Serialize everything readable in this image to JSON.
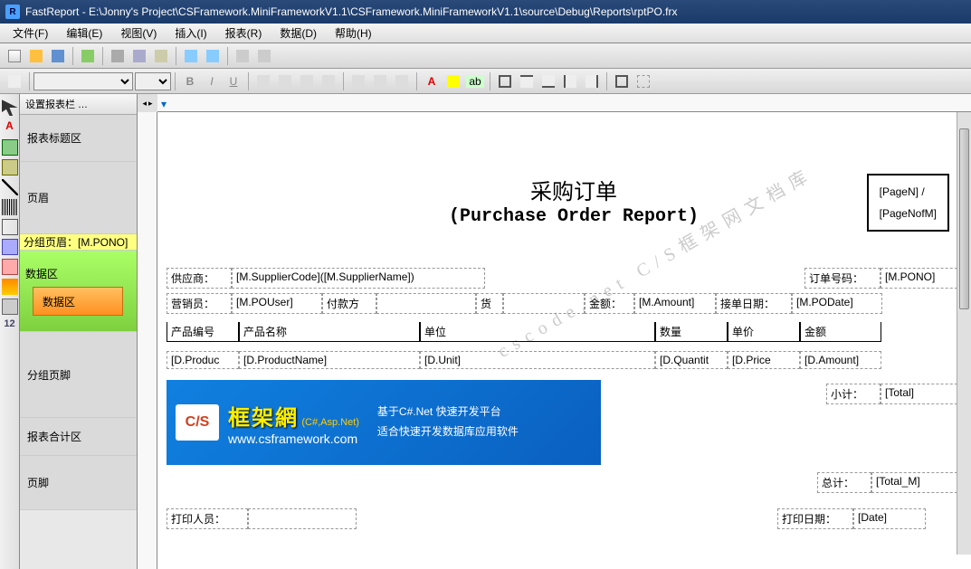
{
  "app": {
    "name": "FastReport",
    "filepath": "E:\\Jonny's Project\\CSFramework.MiniFrameworkV1.1\\CSFramework.MiniFrameworkV1.1\\source\\Debug\\Reports\\rptPO.frx"
  },
  "menu": {
    "file": "文件(F)",
    "edit": "编辑(E)",
    "view": "视图(V)",
    "insert": "插入(I)",
    "report": "报表(R)",
    "data": "数据(D)",
    "help": "帮助(H)"
  },
  "panel": {
    "header": "设置报表栏 …",
    "bands": {
      "title": "报表标题区",
      "page_header": "页眉",
      "group_header": "分组页眉：[M.PONO]",
      "data_outer": "数据区",
      "data_inner": "数据区",
      "group_footer": "分组页脚",
      "report_summary": "报表合计区",
      "page_footer": "页脚"
    }
  },
  "report": {
    "title_cn": "采购订单",
    "title_en": "(Purchase Order Report)",
    "page_n": "[PageN] /",
    "page_nofm": "[PageNofM]",
    "supplier_label": "供应商：",
    "supplier_val": "[M.SupplierCode]([M.SupplierName])",
    "po_label": "订单号码：",
    "po_val": "[M.PONO]",
    "sales_label": "营销员：",
    "sales_val": "[M.POUser]",
    "pay_label": "付款方",
    "currency_label": "货",
    "amount_label": "金额：",
    "amount_val": "[M.Amount]",
    "accept_date_label": "接单日期：",
    "accept_date_val": "[M.PODate]",
    "th": {
      "code": "产品编号",
      "name": "产品名称",
      "unit": "单位",
      "qty": "数量",
      "price": "单价",
      "amount": "金额"
    },
    "td": {
      "code": "[D.Produc",
      "name": "[D.ProductName]",
      "unit": "[D.Unit]",
      "qty": "[D.Quantit",
      "price": "[D.Price",
      "amount": "[D.Amount]"
    },
    "subtotal_label": "小计：",
    "subtotal_val": "[Total]",
    "total_label": "总计：",
    "total_val": "[Total_M]",
    "printer_label": "打印人员：",
    "print_date_label": "打印日期：",
    "print_date_val": "[Date]"
  },
  "banner": {
    "logo": "C/S",
    "brand": "框架網",
    "sub": "(C#,Asp.Net)",
    "url": "www.csframework.com",
    "desc1": "基于C#.Net 快速开发平台",
    "desc2": "适合快速开发数据库应用软件"
  },
  "watermark": "cscode.net\nC/S框架网文档库"
}
